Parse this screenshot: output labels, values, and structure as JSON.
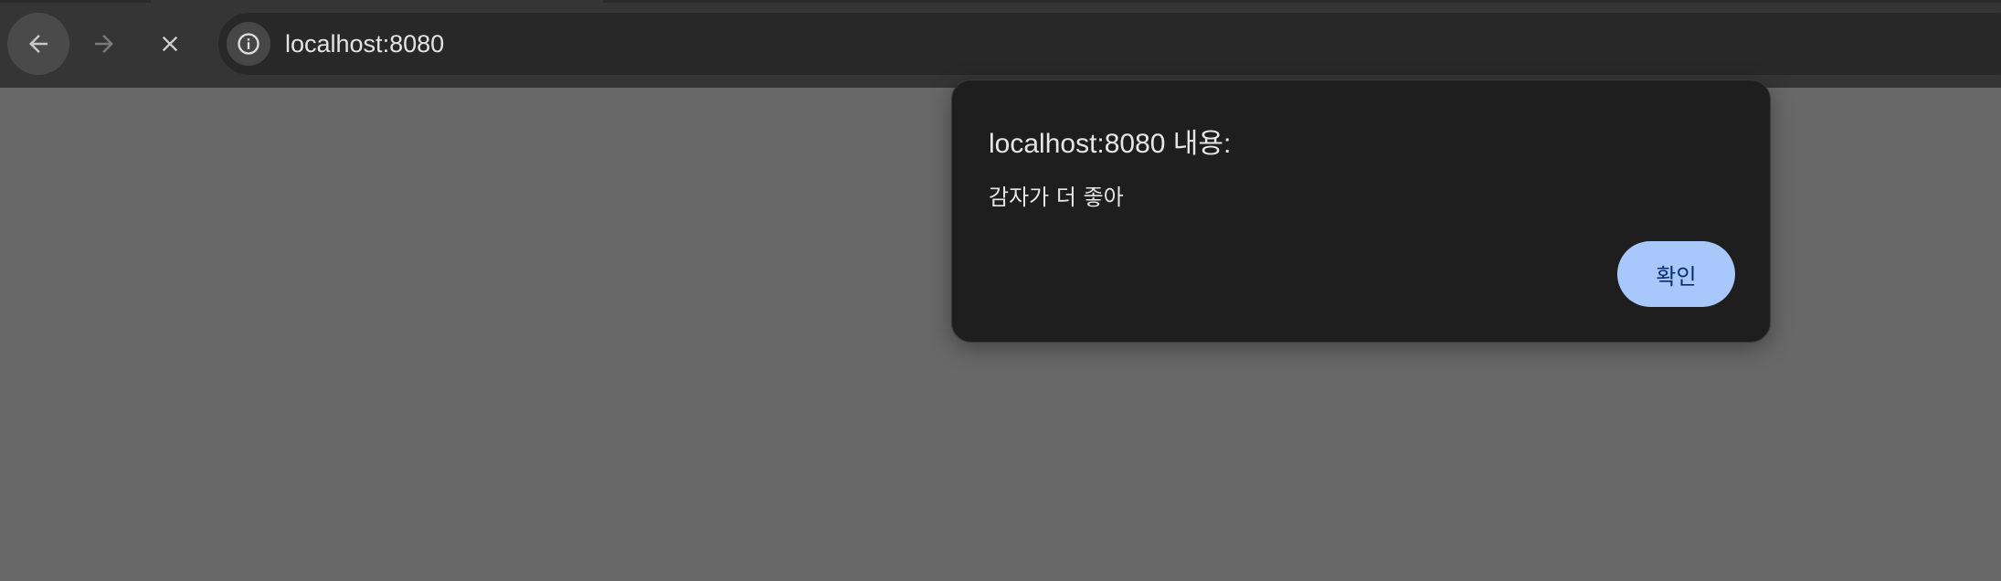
{
  "browser": {
    "url": "localhost:8080"
  },
  "dialog": {
    "title": "localhost:8080 내용:",
    "message": "감자가 더 좋아",
    "ok_label": "확인"
  },
  "colors": {
    "page_background": "#686868",
    "toolbar": "#353535",
    "dialog_background": "#1e1e1e",
    "button_background": "#a8c7fa",
    "button_text": "#062e6f"
  }
}
